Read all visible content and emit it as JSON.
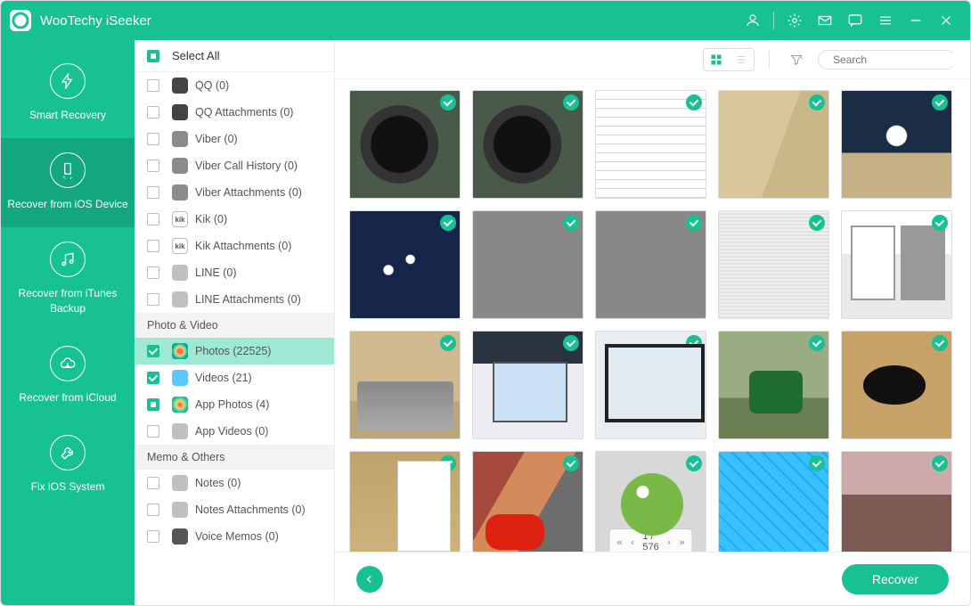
{
  "app": {
    "title": "WooTechy iSeeker"
  },
  "titlebar_icons": [
    "account",
    "settings",
    "mail",
    "feedback",
    "menu",
    "minimize",
    "close"
  ],
  "nav": {
    "items": [
      {
        "id": "smart",
        "label": "Smart Recovery"
      },
      {
        "id": "device",
        "label": "Recover from iOS Device"
      },
      {
        "id": "itunes",
        "label": "Recover from iTunes Backup"
      },
      {
        "id": "icloud",
        "label": "Recover from iCloud"
      },
      {
        "id": "fix",
        "label": "Fix iOS System"
      }
    ],
    "active": "device"
  },
  "filelist": {
    "select_all_label": "Select All",
    "select_all_state": "partial",
    "groups": [
      {
        "items": [
          {
            "id": "qq",
            "icon": "qq",
            "label": "QQ (0)",
            "state": "unchecked"
          },
          {
            "id": "qqatt",
            "icon": "qq",
            "label": "QQ Attachments (0)",
            "state": "unchecked"
          },
          {
            "id": "viber",
            "icon": "viber",
            "label": "Viber (0)",
            "state": "unchecked"
          },
          {
            "id": "viberch",
            "icon": "viber",
            "label": "Viber Call History (0)",
            "state": "unchecked"
          },
          {
            "id": "viberatt",
            "icon": "viber",
            "label": "Viber Attachments (0)",
            "state": "unchecked"
          },
          {
            "id": "kik",
            "icon": "kik",
            "label": "Kik (0)",
            "state": "unchecked"
          },
          {
            "id": "kikatt",
            "icon": "kik",
            "label": "Kik Attachments (0)",
            "state": "unchecked"
          },
          {
            "id": "line",
            "icon": "line",
            "label": "LINE (0)",
            "state": "unchecked"
          },
          {
            "id": "lineatt",
            "icon": "line",
            "label": "LINE Attachments (0)",
            "state": "unchecked"
          }
        ]
      },
      {
        "title": "Photo & Video",
        "items": [
          {
            "id": "photos",
            "icon": "photos",
            "label": "Photos (22525)",
            "state": "checked",
            "selected": true
          },
          {
            "id": "videos",
            "icon": "videos",
            "label": "Videos (21)",
            "state": "checked"
          },
          {
            "id": "appphotos",
            "icon": "appp",
            "label": "App Photos (4)",
            "state": "partial"
          },
          {
            "id": "appvideos",
            "icon": "appv",
            "label": "App Videos (0)",
            "state": "unchecked"
          }
        ]
      },
      {
        "title": "Memo & Others",
        "items": [
          {
            "id": "notes",
            "icon": "notes",
            "label": "Notes (0)",
            "state": "unchecked"
          },
          {
            "id": "notesatt",
            "icon": "notes",
            "label": "Notes Attachments (0)",
            "state": "unchecked"
          },
          {
            "id": "vmemos",
            "icon": "voice",
            "label": "Voice Memos (0)",
            "state": "unchecked"
          }
        ]
      }
    ]
  },
  "toolbar": {
    "view": "grid",
    "search_placeholder": "Search"
  },
  "grid": {
    "thumbs": [
      "th1",
      "th1",
      "th2",
      "th3",
      "th4",
      "th5",
      "th6",
      "th6",
      "th7",
      "th8",
      "th9",
      "",
      "th10",
      "th11",
      "th12",
      "th13",
      "th14",
      "",
      "th15",
      "th16",
      "th17",
      "th18",
      "th19",
      ""
    ],
    "all_checked": true,
    "pager": {
      "page": "1",
      "sep": "/",
      "total": "576"
    }
  },
  "bottom": {
    "recover_label": "Recover"
  }
}
